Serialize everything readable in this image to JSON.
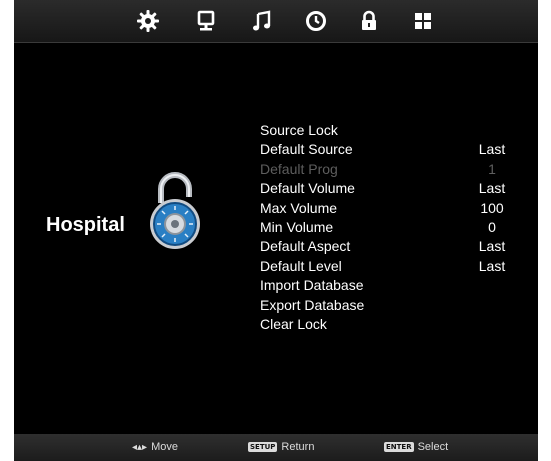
{
  "topbar": {
    "icons": [
      "gear-icon",
      "monitor-icon",
      "music-note-icon",
      "clock-icon",
      "lock-icon",
      "grid-icon"
    ],
    "selected": "lock-icon"
  },
  "menu": {
    "title": "Hospital",
    "icon": "padlock-icon",
    "items": [
      {
        "label": "Source Lock",
        "value": "",
        "enabled": true
      },
      {
        "label": "Default Source",
        "value": "Last",
        "enabled": true
      },
      {
        "label": "Default Prog",
        "value": "1",
        "enabled": false
      },
      {
        "label": "Default Volume",
        "value": "Last",
        "enabled": true
      },
      {
        "label": "Max Volume",
        "value": "100",
        "enabled": true
      },
      {
        "label": "Min Volume",
        "value": "0",
        "enabled": true
      },
      {
        "label": "Default Aspect",
        "value": "Last",
        "enabled": true
      },
      {
        "label": "Default Level",
        "value": "Last",
        "enabled": true
      },
      {
        "label": "Import Database",
        "value": "",
        "enabled": true
      },
      {
        "label": "Export Database",
        "value": "",
        "enabled": true
      },
      {
        "label": "Clear Lock",
        "value": "",
        "enabled": true
      }
    ]
  },
  "footer": {
    "move": {
      "label": "Move",
      "icon": "arrows-icon"
    },
    "return": {
      "key": "SETUP",
      "label": "Return"
    },
    "select": {
      "key": "ENTER",
      "label": "Select"
    }
  },
  "colors": {
    "background": "#000000",
    "text": "#ffffff",
    "disabled_text": "#5e5e5e",
    "lock_blue": "#2a7fc4"
  }
}
